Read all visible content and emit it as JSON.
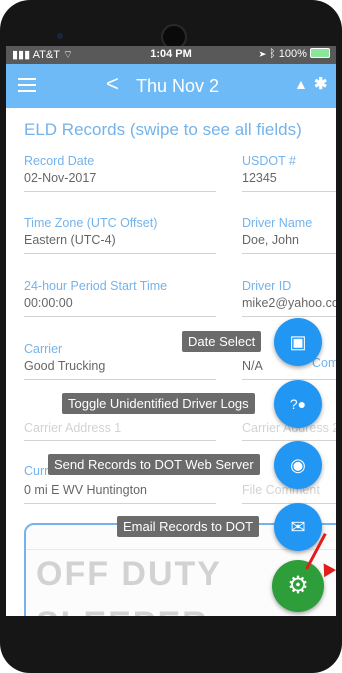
{
  "status": {
    "carrier": "AT&T",
    "time": "1:04 PM",
    "battery": "100%"
  },
  "appbar": {
    "title": "Thu Nov 2"
  },
  "section_title": "ELD Records (swipe to see all fields)",
  "fields": {
    "record_date": {
      "label": "Record Date",
      "value": "02-Nov-2017"
    },
    "usdot": {
      "label": "USDOT #",
      "value": "12345"
    },
    "time_zone": {
      "label": "Time Zone (UTC Offset)",
      "value": "Eastern (UTC-4)"
    },
    "driver_name": {
      "label": "Driver Name",
      "value": "Doe, John"
    },
    "period_start": {
      "label": "24-hour Period Start Time",
      "value": "00:00:00"
    },
    "driver_id": {
      "label": "Driver ID",
      "value": "mike2@yahoo.co"
    },
    "carrier": {
      "label": "Carrier",
      "value": "Good Trucking"
    },
    "carrier_other": {
      "label": "t Com",
      "value": "N/A"
    },
    "carrier_address_1": {
      "placeholder": "Carrier Address 1"
    },
    "carrier_address_2": {
      "placeholder": "Carrier Address 2"
    },
    "current_location": {
      "label": "Curr",
      "value": "0 mi E WV Huntington"
    },
    "file_comment": {
      "placeholder": "File Comment"
    }
  },
  "stamp": {
    "line1": "OFF DUTY",
    "line2": "SLEEPER"
  },
  "fab_menu": {
    "date_select": "Date Select",
    "toggle_unidentified": "Toggle Unidentified Driver Logs",
    "send_records": "Send Records to DOT Web Server",
    "email_records": "Email Records to DOT"
  },
  "icons": {
    "menu": "menu-icon",
    "back": "chevron-left-icon",
    "warning": "warning-icon",
    "bluetooth": "bluetooth-icon",
    "calendar": "calendar-icon",
    "user_unknown": "unknown-user-icon",
    "wifi": "wifi-icon",
    "mail": "mail-icon",
    "settings": "gear-icon"
  },
  "colors": {
    "primary": "#2196f3",
    "fab_main": "#2e9e3a",
    "label": "#2a8ae0",
    "arrow": "#e51c1c"
  }
}
